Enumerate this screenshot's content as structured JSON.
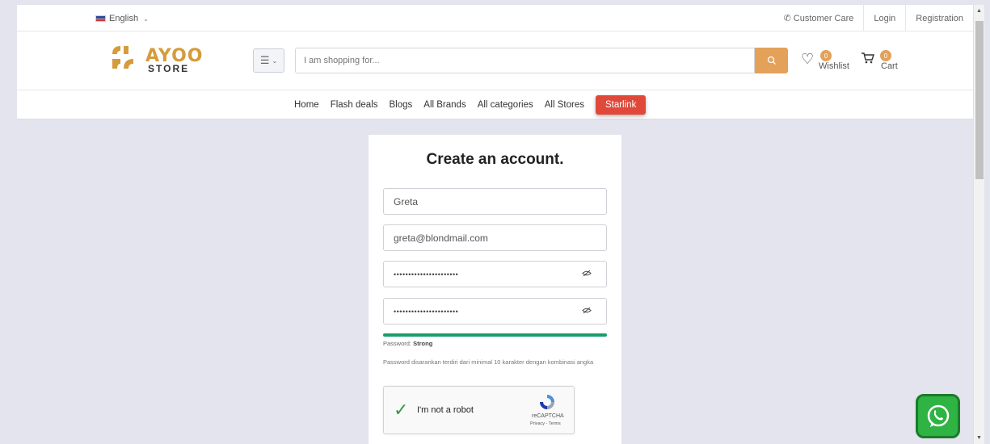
{
  "topbar": {
    "language": "English",
    "links": [
      "Customer Care",
      "Login",
      "Registration"
    ]
  },
  "header": {
    "logo_text": "AYOO",
    "logo_sub": "STORE",
    "search_placeholder": "I am shopping for...",
    "wishlist_label": "Wishlist",
    "wishlist_count": "0",
    "cart_label": "Cart",
    "cart_count": "0"
  },
  "nav": {
    "items": [
      "Home",
      "Flash deals",
      "Blogs",
      "All Brands",
      "All categories",
      "All Stores"
    ],
    "highlight": "Starlink",
    "highlight_color": "#e0493a"
  },
  "form": {
    "title": "Create an account.",
    "name_value": "Greta",
    "email_value": "greta@blondmail.com",
    "password_mask": "••••••••••••••••••••••",
    "confirm_mask": "••••••••••••••••••••••",
    "strength_prefix": "Password: ",
    "strength_value": "Strong",
    "strength_color": "#1a9e6a",
    "note": "Password disarankan terdiri dari minimal 10 karakter dengan kombinasi angka"
  },
  "captcha": {
    "label": "I'm not a robot",
    "brand": "reCAPTCHA",
    "links": "Privacy - Terms"
  },
  "colors": {
    "accent": "#e3a15a",
    "whatsapp": "#2fb343"
  }
}
